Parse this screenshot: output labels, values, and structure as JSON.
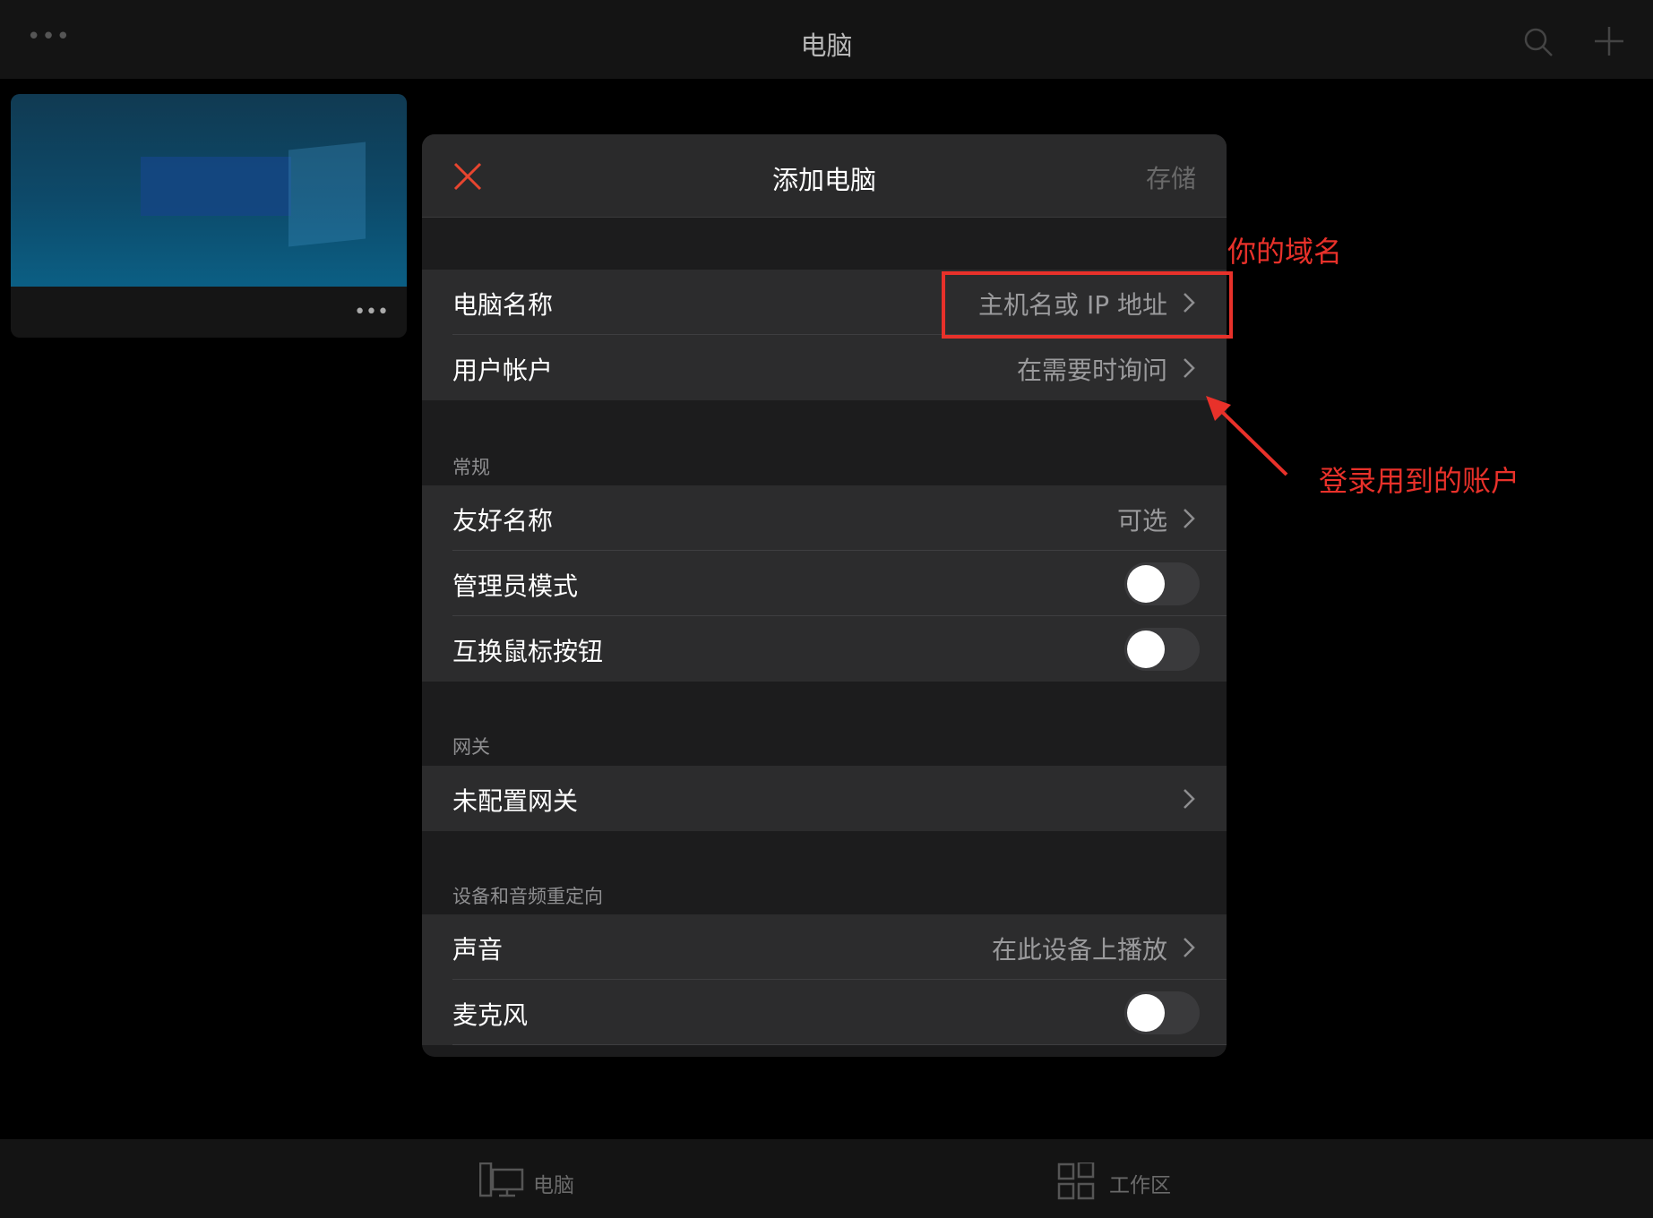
{
  "topbar": {
    "title": "电脑",
    "more": "•••"
  },
  "thumbnail": {
    "more": "•••"
  },
  "modal": {
    "title": "添加电脑",
    "save_label": "存储",
    "rows": {
      "pc_name": {
        "label": "电脑名称",
        "value": "主机名或 IP 地址"
      },
      "user_account": {
        "label": "用户帐户",
        "value": "在需要时询问"
      },
      "friendly_name": {
        "label": "友好名称",
        "value": "可选"
      },
      "admin_mode": {
        "label": "管理员模式",
        "on": false
      },
      "swap_mouse": {
        "label": "互换鼠标按钮",
        "on": false
      },
      "gateway": {
        "label": "未配置网关"
      },
      "sound": {
        "label": "声音",
        "value": "在此设备上播放"
      },
      "microphone": {
        "label": "麦克风",
        "on": false
      }
    },
    "sections": {
      "general": "常规",
      "gateway": "网关",
      "redirection": "设备和音频重定向"
    }
  },
  "annotations": {
    "domain_note": "你的域名",
    "account_note": "登录用到的账户",
    "color": "#e8312a"
  },
  "bottom_tabs": {
    "pc": "电脑",
    "workspace": "工作区"
  }
}
